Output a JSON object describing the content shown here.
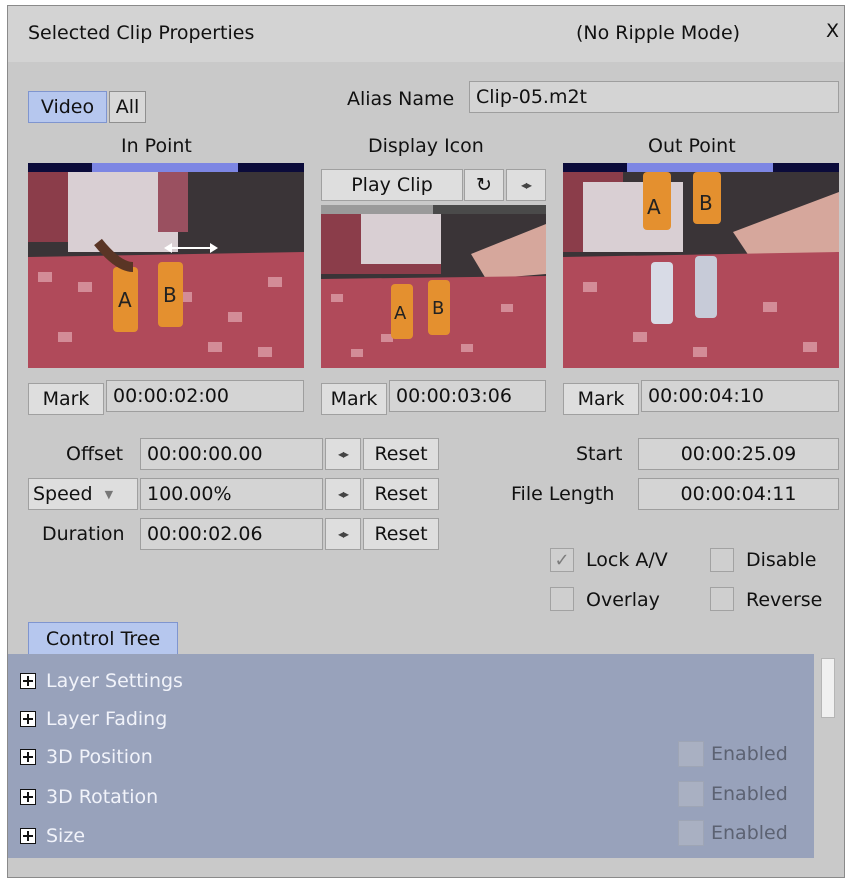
{
  "window": {
    "title": "Selected Clip Properties",
    "mode": "(No Ripple Mode)",
    "close_label": "X"
  },
  "tabs": [
    {
      "label": "Video",
      "active": true
    },
    {
      "label": "All",
      "active": false
    }
  ],
  "alias": {
    "label": "Alias Name",
    "value": "Clip-05.m2t"
  },
  "panels": {
    "in_point": {
      "header": "In Point",
      "mark_label": "Mark",
      "timecode": "00:00:02:00"
    },
    "display_icon": {
      "header": "Display Icon",
      "play_label": "Play Clip",
      "mark_label": "Mark",
      "timecode": "00:00:03:06"
    },
    "out_point": {
      "header": "Out Point",
      "mark_label": "Mark",
      "timecode": "00:00:04:10"
    }
  },
  "params": {
    "offset": {
      "label": "Offset",
      "value": "00:00:00.00",
      "reset_label": "Reset"
    },
    "speed": {
      "label": "Speed",
      "value": "100.00%",
      "reset_label": "Reset"
    },
    "duration": {
      "label": "Duration",
      "value": "00:00:02.06",
      "reset_label": "Reset"
    }
  },
  "info": {
    "start": {
      "label": "Start",
      "value": "00:00:25.09"
    },
    "file_length": {
      "label": "File Length",
      "value": "00:00:04:11"
    }
  },
  "options": {
    "lock_av": {
      "label": "Lock A/V",
      "checked": true
    },
    "disable": {
      "label": "Disable",
      "checked": false
    },
    "overlay": {
      "label": "Overlay",
      "checked": false
    },
    "reverse": {
      "label": "Reverse",
      "checked": false
    }
  },
  "control_tree": {
    "tab_label": "Control Tree",
    "items": [
      {
        "label": "Layer Settings",
        "enabled_label": ""
      },
      {
        "label": "Layer Fading",
        "enabled_label": ""
      },
      {
        "label": "3D Position",
        "enabled_label": "Enabled"
      },
      {
        "label": "3D Rotation",
        "enabled_label": "Enabled"
      },
      {
        "label": "Size",
        "enabled_label": "Enabled"
      }
    ]
  },
  "icons": {
    "plus": "plus-box-icon",
    "loop": "loop-icon",
    "step": "left-right-arrows-icon",
    "dropdown": "chevron-down-icon",
    "check": "checkmark-icon"
  },
  "colors": {
    "active_tab": "#b6c7ee",
    "tree_background": "#98a2bb",
    "timeline_selection": "#7d86e3",
    "timeline_track": "#0b0b3a"
  }
}
